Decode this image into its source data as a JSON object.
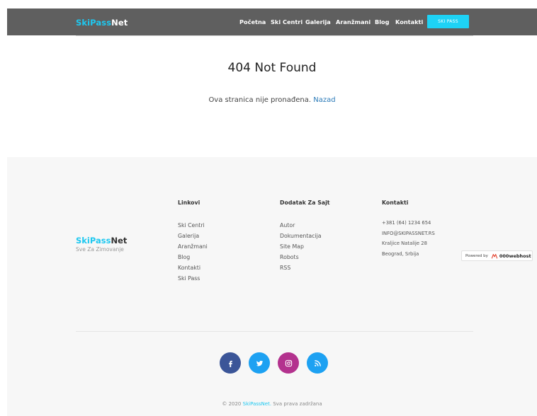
{
  "header": {
    "logo_part1": "SkiPass",
    "logo_part2": "Net",
    "nav": [
      "Početna",
      "Ski Centri",
      "Galerija",
      "Aranžmani",
      "Blog",
      "Kontakti"
    ],
    "button_label": "SKI PASS"
  },
  "main": {
    "title": "404 Not Found",
    "message": "Ova stranica nije pronađena.",
    "back_link": "Nazad"
  },
  "footer": {
    "logo_part1": "SkiPass",
    "logo_part2": "Net",
    "tagline": "Sve Za Zimovanje",
    "columns": [
      {
        "heading": "Linkovi",
        "items": [
          "Ski Centri",
          "Galerija",
          "Aranžmani",
          "Blog",
          "Kontakti",
          "Ski Pass"
        ]
      },
      {
        "heading": "Dodatak Za Sajt",
        "items": [
          "Autor",
          "Dokumentacija",
          "Site Map",
          "Robots",
          "RSS"
        ]
      },
      {
        "heading": "Kontakti",
        "items": [
          "+381 (64) 1234 654",
          "INFO@SKIPASSNET.RS",
          "Kraljice Natalije 28",
          "Beograd, Srbija"
        ]
      }
    ],
    "social_icons": [
      "facebook-icon",
      "twitter-icon",
      "instagram-icon",
      "rss-icon"
    ],
    "copyright_prefix": "© 2020",
    "copyright_brand": "SkiPassNet.",
    "copyright_suffix": "Sva prava zadržana",
    "powered_text": "Powered by",
    "powered_brand": "000webhost"
  },
  "colors": {
    "accent": "#1ec8f0",
    "header_bg": "#5f5f5f",
    "facebook": "#3b5598",
    "twitter": "#1da1f2",
    "instagram": "#b3328e",
    "rss": "#1da1f2"
  }
}
